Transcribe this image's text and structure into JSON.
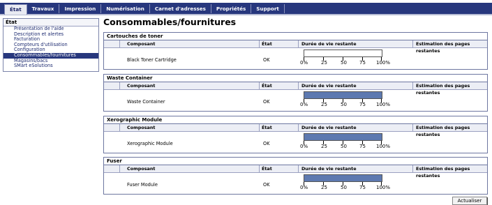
{
  "nav": {
    "tabs": [
      {
        "label": "État",
        "active": true
      },
      {
        "label": "Travaux",
        "active": false
      },
      {
        "label": "Impression",
        "active": false
      },
      {
        "label": "Numérisation",
        "active": false
      },
      {
        "label": "Carnet d'adresses",
        "active": false
      },
      {
        "label": "Propriétés",
        "active": false
      },
      {
        "label": "Support",
        "active": false
      }
    ]
  },
  "sidebar": {
    "title": "État",
    "items": [
      {
        "label": "Présentation de l'aide",
        "selected": false
      },
      {
        "label": "Description et alertes",
        "selected": false
      },
      {
        "label": "Facturation",
        "selected": false
      },
      {
        "label": "Compteurs d'utilisation",
        "selected": false
      },
      {
        "label": "Configuration",
        "selected": false
      },
      {
        "label": "Consommables/fournitures",
        "selected": true
      },
      {
        "label": "Magasins/bacs",
        "selected": false
      },
      {
        "label": "SMart eSolutions",
        "selected": false
      }
    ]
  },
  "page": {
    "title": "Consommables/fournitures"
  },
  "columns": {
    "component": "Composant",
    "state": "État",
    "life": "Durée de vie restante",
    "pages": "Estimation des pages restantes"
  },
  "scale": [
    "0%",
    "25",
    "50",
    "75",
    "100%"
  ],
  "sections": [
    {
      "title": "Cartouches de toner",
      "component": "Black Toner Cartridge",
      "state": "OK",
      "remaining_fraction": 0.0,
      "pages": ""
    },
    {
      "title": "Waste Container",
      "component": "Waste Container",
      "state": "OK",
      "remaining_fraction": 1.0,
      "pages": ""
    },
    {
      "title": "Xerographic Module",
      "component": "Xerographic Module",
      "state": "OK",
      "remaining_fraction": 1.0,
      "pages": ""
    },
    {
      "title": "Fuser",
      "component": "Fuser Module",
      "state": "OK",
      "remaining_fraction": 1.0,
      "pages": ""
    }
  ],
  "actions": {
    "refresh_label": "Actualiser"
  },
  "colors": {
    "nav_bg": "#27377d",
    "gauge_fill": "#5d79b0",
    "selected_bg": "#27377d"
  }
}
